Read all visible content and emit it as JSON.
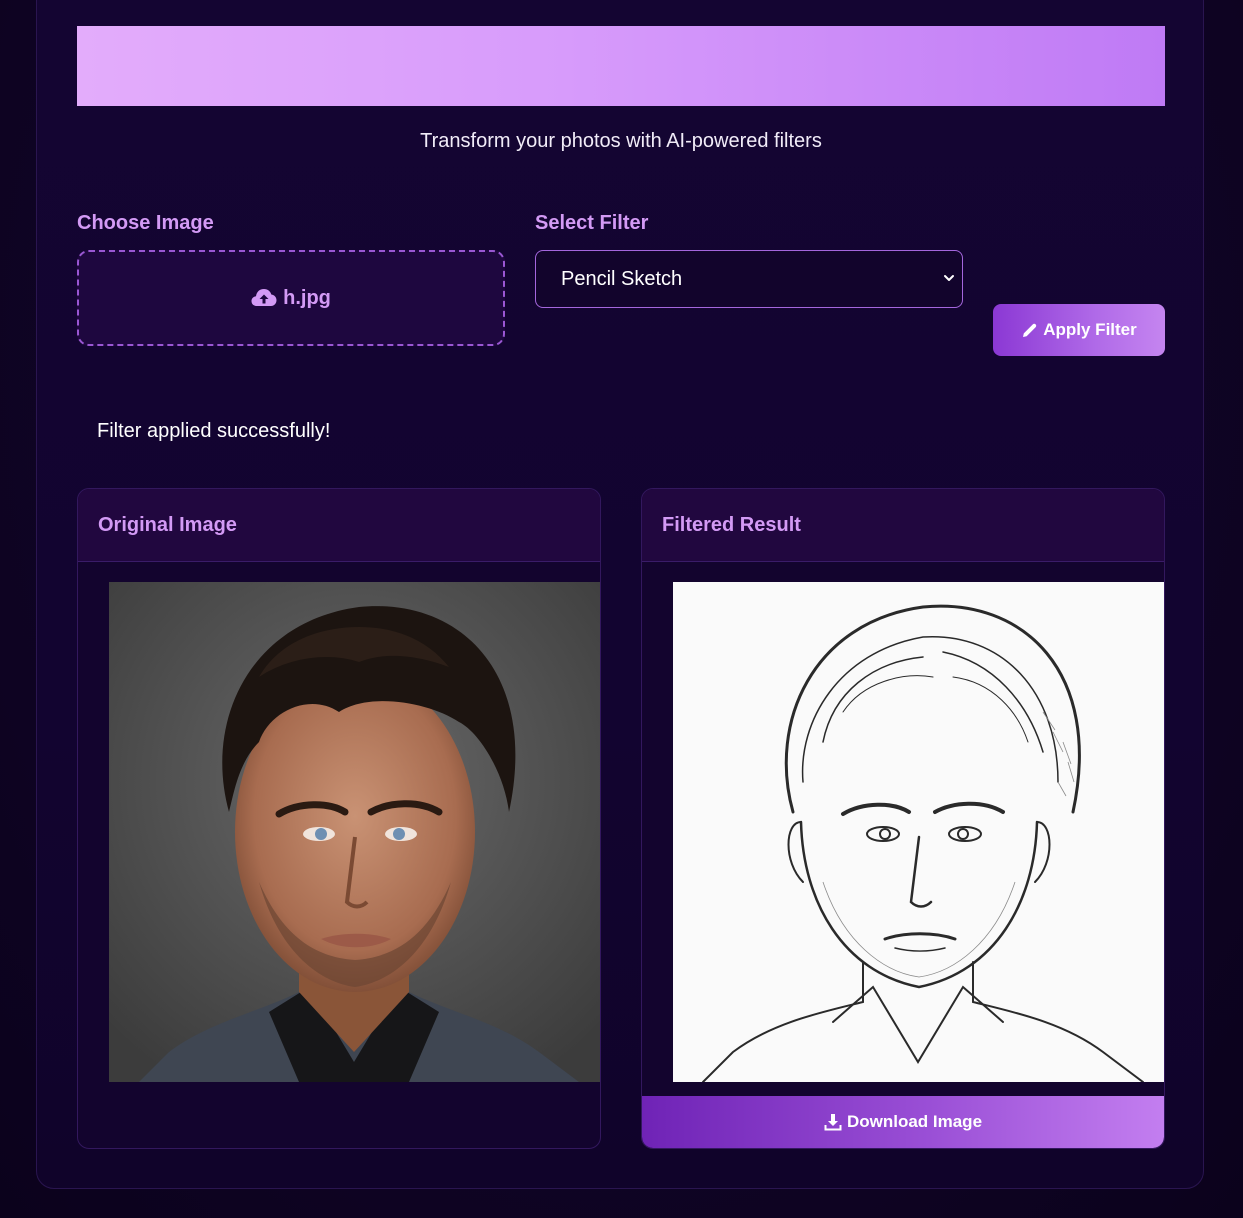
{
  "header": {
    "tagline": "Transform your photos with AI-powered filters"
  },
  "upload": {
    "label": "Choose Image",
    "file_name": "h.jpg",
    "icon": "cloud-upload-icon"
  },
  "filter": {
    "label": "Select Filter",
    "selected": "Pencil Sketch"
  },
  "apply_button": {
    "label": "Apply Filter",
    "icon": "pencil-icon"
  },
  "status_message": "Filter applied successfully!",
  "original_panel": {
    "title": "Original Image"
  },
  "result_panel": {
    "title": "Filtered Result",
    "download_label": "Download Image",
    "download_icon": "download-icon"
  },
  "colors": {
    "accent": "#d39af5",
    "banner_start": "#e3acfb",
    "banner_end": "#bf7af5",
    "background": "#0e0424"
  }
}
